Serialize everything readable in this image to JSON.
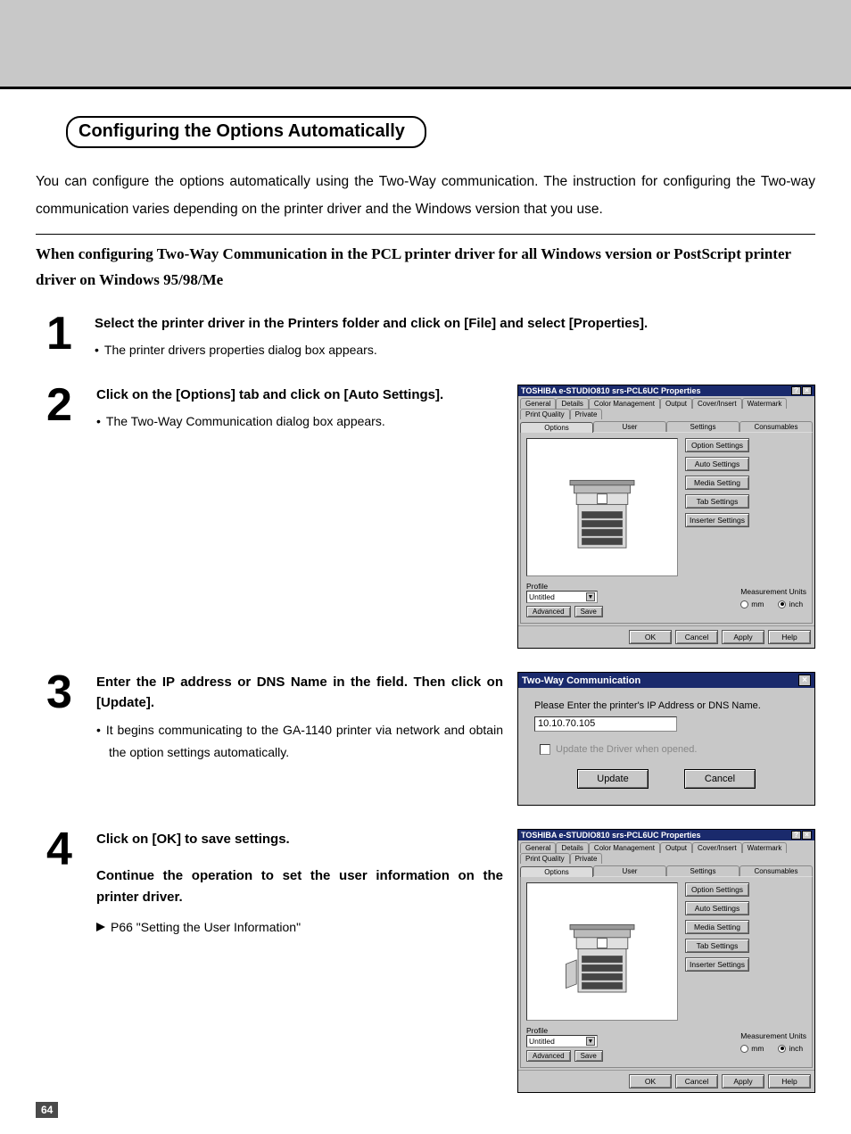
{
  "page_number": "64",
  "section_title": "Configuring the Options Automatically",
  "intro": "You can configure the options automatically using the Two-Way communication.  The instruction for configuring the Two-way communication varies depending on the printer driver and the Windows version that you use.",
  "subhead": "When configuring Two-Way Communication in the PCL printer driver for all Windows version or PostScript printer driver on Windows 95/98/Me",
  "steps": {
    "s1": {
      "num": "1",
      "title": "Select the printer driver in the Printers folder and click on [File] and select [Properties].",
      "note": "The printer drivers properties dialog box appears."
    },
    "s2": {
      "num": "2",
      "title": "Click on the [Options] tab and click on [Auto Settings].",
      "note": "The Two-Way Communication dialog box appears."
    },
    "s3": {
      "num": "3",
      "title": "Enter the IP address or DNS Name in the field. Then click on [Update].",
      "note": "It begins communicating to the GA-1140 printer via network and obtain the option settings automatically."
    },
    "s4": {
      "num": "4",
      "title1": "Click on [OK] to save settings.",
      "title2": "Continue the operation to set the user information on the printer driver.",
      "xref": "P66 \"Setting the User Information\""
    }
  },
  "props_dialog": {
    "title": "TOSHIBA e-STUDIO810 srs-PCL6UC Properties",
    "tabs_row1": [
      "General",
      "Details",
      "Color Management",
      "Output",
      "Cover/Insert",
      "Watermark",
      "Print Quality",
      "Private"
    ],
    "tabs_row2": [
      "Options",
      "User",
      "Settings",
      "Consumables"
    ],
    "side_buttons": [
      "Option Settings",
      "Auto Settings",
      "Media Setting",
      "Tab Settings",
      "Inserter Settings"
    ],
    "profile_label": "Profile",
    "profile_value": "Untitled",
    "profile_btns": [
      "Advanced",
      "Save"
    ],
    "units_label": "Measurement Units",
    "unit_mm": "mm",
    "unit_inch": "inch",
    "footer": [
      "OK",
      "Cancel",
      "Apply",
      "Help"
    ]
  },
  "twoway_dialog": {
    "title": "Two-Way Communication",
    "prompt": "Please Enter the printer's IP Address or DNS Name.",
    "ip_value": "10.10.70.105",
    "checkbox_label": "Update the Driver when opened.",
    "update_btn": "Update",
    "cancel_btn": "Cancel"
  }
}
